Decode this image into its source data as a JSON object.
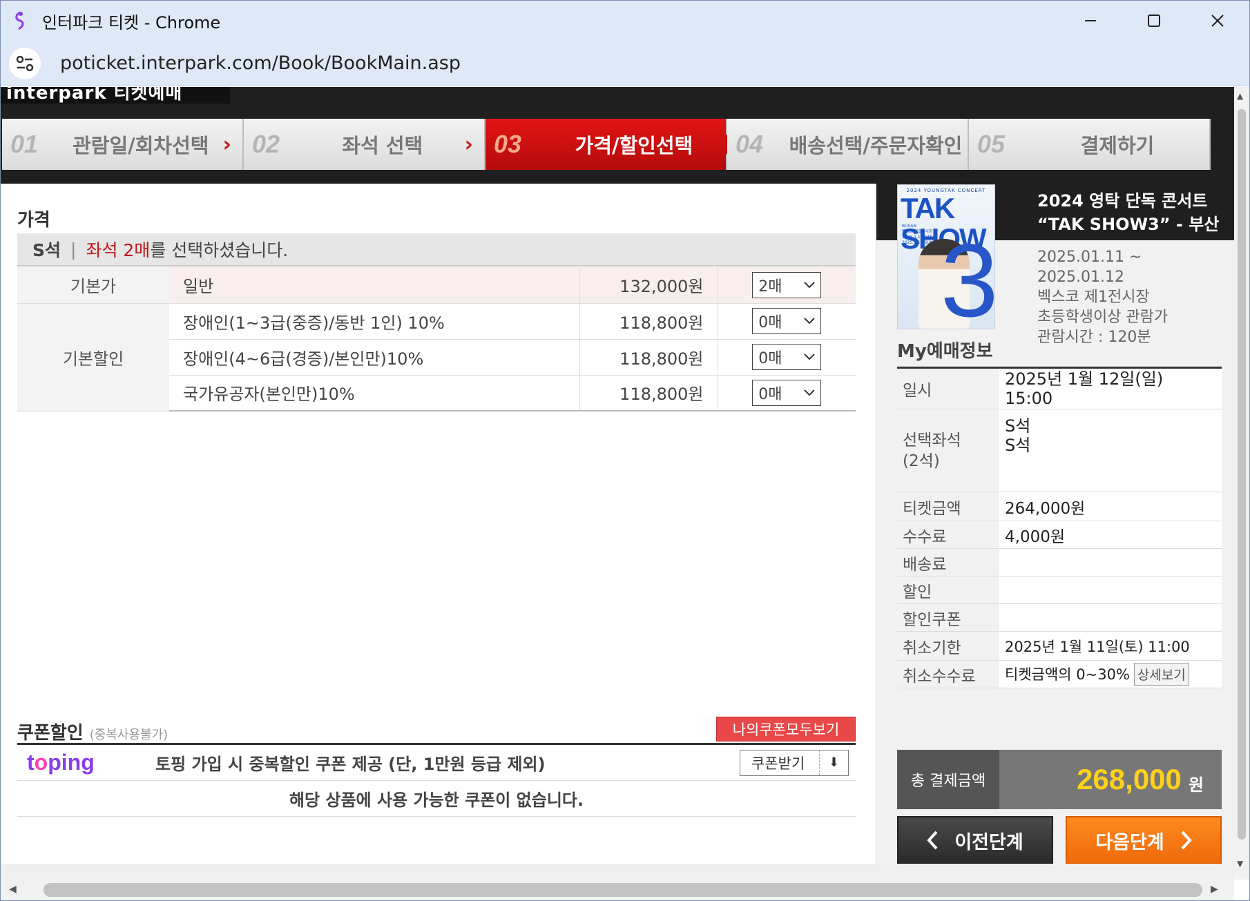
{
  "window": {
    "title": "인터파크 티켓 - Chrome",
    "url": "poticket.interpark.com/Book/BookMain.asp"
  },
  "brand": "interpark 티켓예매",
  "steps": [
    {
      "num": "01",
      "label": "관람일/회차선택"
    },
    {
      "num": "02",
      "label": "좌석 선택"
    },
    {
      "num": "03",
      "label": "가격/할인선택",
      "active": true
    },
    {
      "num": "04",
      "label": "배송선택/주문자확인"
    },
    {
      "num": "05",
      "label": "결제하기"
    }
  ],
  "price": {
    "section_title": "가격",
    "grade": "S석",
    "sel_red": "좌석 2매",
    "sel_rest": "를 선택하셨습니다.",
    "rows": [
      {
        "category": "기본가",
        "name": "일반",
        "price": "132,000원",
        "qty": "2매"
      },
      {
        "category": "기본할인",
        "name": "장애인(1~3급(중증)/동반 1인) 10%",
        "price": "118,800원",
        "qty": "0매"
      },
      {
        "name": "장애인(4~6급(경증)/본인만)10%",
        "price": "118,800원",
        "qty": "0매"
      },
      {
        "name": "국가유공자(본인만)10%",
        "price": "118,800원",
        "qty": "0매"
      }
    ]
  },
  "coupon": {
    "title": "쿠폰할인",
    "note": "(중복사용불가)",
    "all_button": "나의쿠폰모두보기",
    "toping_pre": "t",
    "toping_o": "o",
    "toping_post": "ping",
    "toping_text": "토핑 가입 시 중복할인 쿠폰 제공 (단, 1만원 등급 제외)",
    "get_button": "쿠폰받기",
    "empty": "해당 상품에 사용 가능한 쿠폰이 없습니다."
  },
  "performance": {
    "poster_top": "2024 YOUNGTAK CONCERT",
    "poster_title": "TAK SHOW",
    "poster_num": "3",
    "poster_small": "BUSAN\n벡스코 제1전시장\n2025.1.11 SAT\n2025.1.12 SUN",
    "title_line1": "2024 영탁 단독 콘서트",
    "title_line2": "“TAK SHOW3” - 부산",
    "date_line1": "2025.01.11 ~",
    "date_line2": "2025.01.12",
    "venue": "벡스코 제1전시장",
    "age": "초등학생이상 관람가",
    "runtime": "관람시간 : 120분"
  },
  "my": {
    "title": "My예매정보",
    "datetime_label": "일시",
    "datetime_value1": "2025년 1월 12일(일)",
    "datetime_value2": "15:00",
    "seat_label1": "선택좌석",
    "seat_label2": "(2석)",
    "seat_value1": "S석",
    "seat_value2": "S석",
    "ticket_label": "티켓금액",
    "ticket_value": "264,000원",
    "fee_label": "수수료",
    "fee_value": "4,000원",
    "delivery_label": "배송료",
    "discount_label": "할인",
    "coupon_label": "할인쿠폰",
    "cancel_deadline_label": "취소기한",
    "cancel_deadline_value": "2025년 1월 11일(토) 11:00",
    "cancel_fee_label": "취소수수료",
    "cancel_fee_value": "티켓금액의 0~30%",
    "detail_button": "상세보기",
    "total_label": "총 결제금액",
    "total_value": "268,000",
    "total_unit": "원"
  },
  "nav": {
    "prev": "이전단계",
    "next": "다음단계"
  },
  "colors": {
    "accent_red": "#c0171c",
    "active_step": "#d61212",
    "next_button": "#f47a12",
    "total_amount": "#ffd11a"
  }
}
